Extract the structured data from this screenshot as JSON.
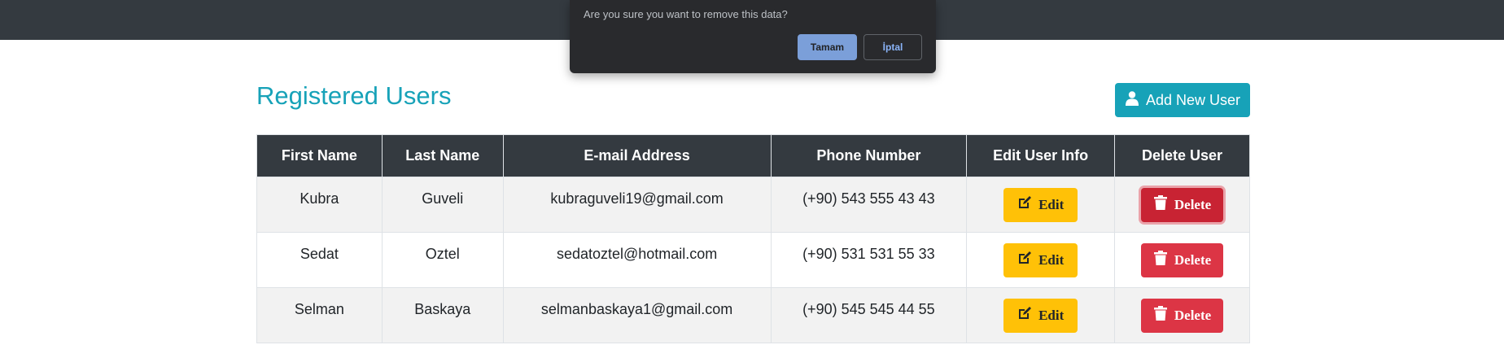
{
  "dialog": {
    "message": "Are you sure you want to remove this data?",
    "ok_label": "Tamam",
    "cancel_label": "İptal"
  },
  "page": {
    "title": "Registered Users",
    "add_button_label": "Add New User"
  },
  "table": {
    "headers": [
      "First Name",
      "Last Name",
      "E-mail Address",
      "Phone Number",
      "Edit User Info",
      "Delete User"
    ],
    "edit_label": "Edit",
    "delete_label": "Delete",
    "rows": [
      {
        "first_name": "Kubra",
        "last_name": "Guveli",
        "email": "kubraguveli19@gmail.com",
        "phone": "(+90) 543 555 43 43"
      },
      {
        "first_name": "Sedat",
        "last_name": "Oztel",
        "email": "sedatoztel@hotmail.com",
        "phone": "(+90) 531 531 55 33"
      },
      {
        "first_name": "Selman",
        "last_name": "Baskaya",
        "email": "selmanbaskaya1@gmail.com",
        "phone": "(+90) 545 545 44 55"
      }
    ]
  },
  "icons": {
    "add_user": "user-icon",
    "edit": "edit-icon",
    "delete": "trash-icon"
  },
  "colors": {
    "navbar": "#343a40",
    "title": "#17a2b8",
    "add_button": "#17a2b8",
    "edit_button": "#ffc107",
    "delete_button": "#dc3545"
  }
}
